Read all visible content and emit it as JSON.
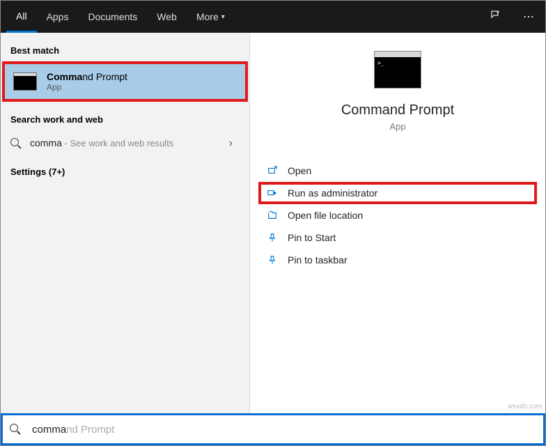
{
  "tabs": {
    "all": "All",
    "apps": "Apps",
    "documents": "Documents",
    "web": "Web",
    "more": "More"
  },
  "left": {
    "best_match_header": "Best match",
    "best_match_title_typed": "Comma",
    "best_match_title_rest": "nd Prompt",
    "best_match_sub": "App",
    "search_section_header": "Search work and web",
    "search_term": "comma",
    "search_hint": " - See work and web results",
    "settings_label": "Settings (7+)"
  },
  "preview": {
    "title": "Command Prompt",
    "sub": "App",
    "actions": {
      "open": "Open",
      "run_admin": "Run as administrator",
      "open_location": "Open file location",
      "pin_start": "Pin to Start",
      "pin_taskbar": "Pin to taskbar"
    }
  },
  "search": {
    "typed": "comma",
    "ghost_suffix": "nd Prompt"
  },
  "watermark": "wsxdn.com"
}
